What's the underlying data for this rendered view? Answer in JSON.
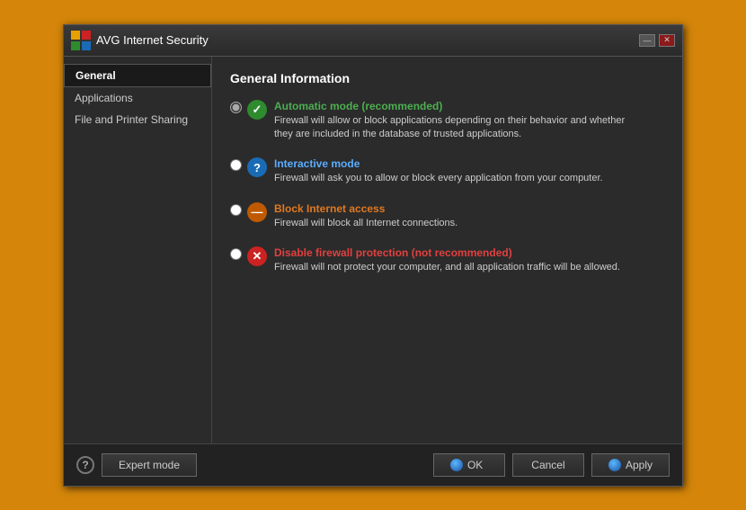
{
  "window": {
    "title": "AVG Internet Security",
    "min_btn": "—",
    "close_btn": "✕"
  },
  "sidebar": {
    "items": [
      {
        "id": "general",
        "label": "General",
        "active": true
      },
      {
        "id": "applications",
        "label": "Applications",
        "active": false
      },
      {
        "id": "file-printer",
        "label": "File and Printer Sharing",
        "active": false
      }
    ]
  },
  "main": {
    "title": "General Information",
    "options": [
      {
        "id": "automatic",
        "label": "Automatic mode (recommended)",
        "label_color": "green",
        "icon_class": "icon-green",
        "icon_char": "✓",
        "desc": "Firewall will allow or block applications depending on their behavior and whether\nthey are included in the database of trusted applications.",
        "checked": true
      },
      {
        "id": "interactive",
        "label": "Interactive mode",
        "label_color": "blue",
        "icon_class": "icon-blue",
        "icon_char": "?",
        "desc": "Firewall will ask you to allow or block every application from your computer.",
        "checked": false
      },
      {
        "id": "block",
        "label": "Block Internet access",
        "label_color": "orange",
        "icon_class": "icon-orange",
        "icon_char": "—",
        "desc": "Firewall will block all Internet connections.",
        "checked": false
      },
      {
        "id": "disable",
        "label": "Disable firewall protection (not recommended)",
        "label_color": "red",
        "icon_class": "icon-red",
        "icon_char": "✕",
        "desc": "Firewall will not protect your computer, and all application traffic will be allowed.",
        "checked": false
      }
    ]
  },
  "footer": {
    "help_label": "?",
    "expert_mode_label": "Expert mode",
    "ok_label": "OK",
    "cancel_label": "Cancel",
    "apply_label": "Apply"
  }
}
